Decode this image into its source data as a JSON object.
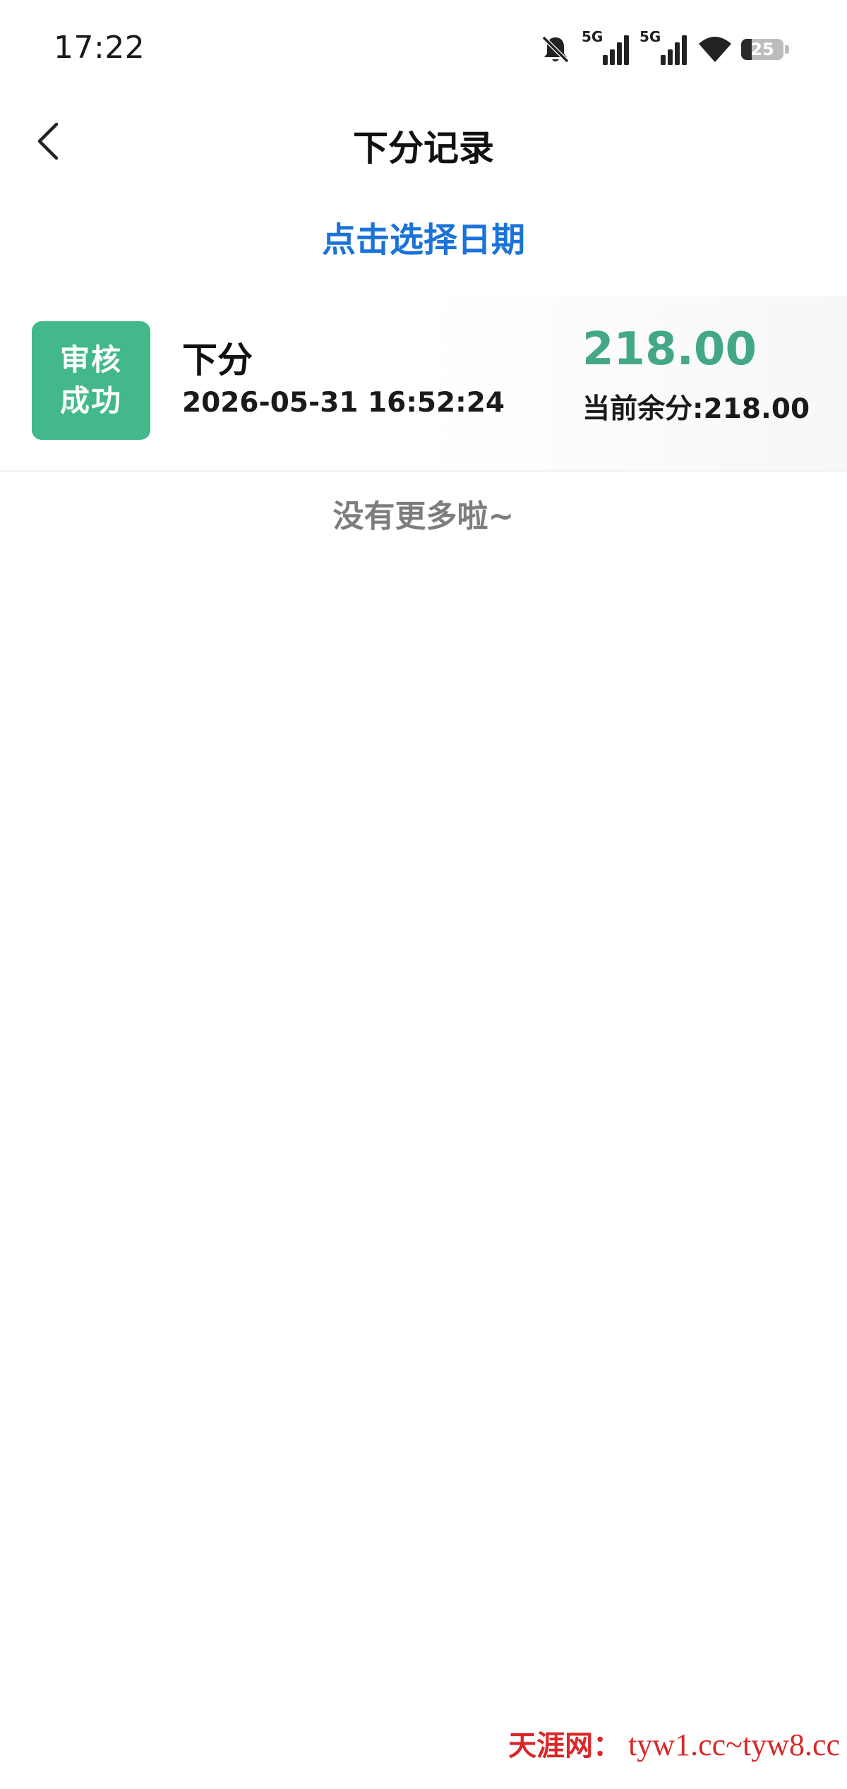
{
  "status_bar": {
    "time": "17:22",
    "network_label_1": "5G",
    "network_label_2": "5G",
    "battery_level": "25"
  },
  "header": {
    "title": "下分记录",
    "back_icon": "chevron-left-icon"
  },
  "date_picker": {
    "label": "点击选择日期"
  },
  "records": [
    {
      "status_line1": "审核",
      "status_line2": "成功",
      "status_color": "#43b88a",
      "type": "下分",
      "time": "2026-05-31 16:52:24",
      "amount": "218.00",
      "amount_color": "#43a884",
      "balance": "当前余分:218.00"
    }
  ],
  "list_footer": {
    "no_more": "没有更多啦~"
  },
  "watermark": {
    "cn": "天涯网：",
    "url": "tyw1.cc~tyw8.cc"
  },
  "colors": {
    "accent_blue": "#1a73d9",
    "success_green": "#43b88a",
    "watermark_red": "#d92727"
  }
}
